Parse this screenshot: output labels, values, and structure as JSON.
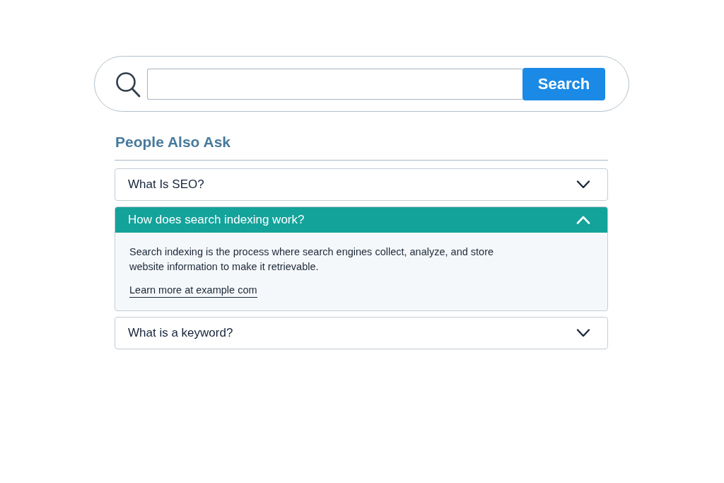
{
  "search": {
    "button": "Search"
  },
  "people_also_ask": {
    "title": "People Also Ask",
    "questions": [
      {
        "question": "What Is SEO?",
        "expanded": false
      },
      {
        "question": "How does search indexing work?",
        "expanded": true,
        "answer": "Search indexing is the process where search engines collect, analyze, and store website information to make it retrievable.",
        "link": "Learn more at example com"
      },
      {
        "question": "What is a keyword?",
        "expanded": false
      }
    ]
  }
}
